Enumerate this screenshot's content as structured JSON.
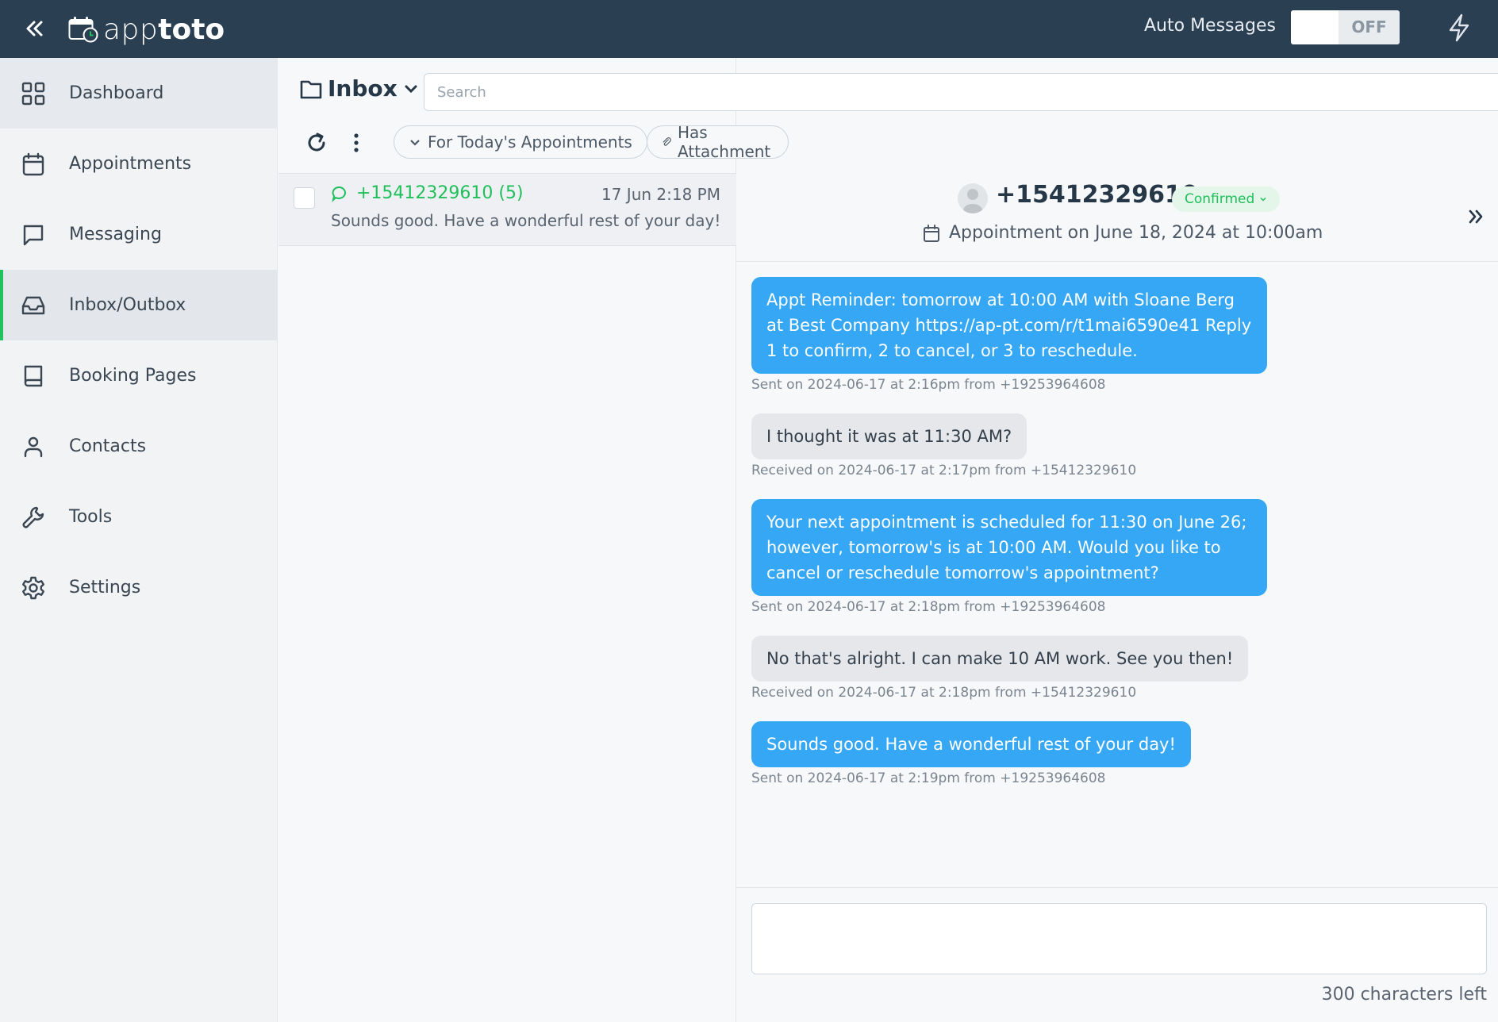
{
  "app": {
    "brand_light": "app",
    "brand_bold": "toto"
  },
  "topbar": {
    "auto_messages_label": "Auto Messages",
    "auto_messages_state": "OFF"
  },
  "sidebar": {
    "items": [
      {
        "label": "Dashboard",
        "icon": "grid-icon"
      },
      {
        "label": "Appointments",
        "icon": "calendar-icon"
      },
      {
        "label": "Messaging",
        "icon": "chat-icon"
      },
      {
        "label": "Inbox/Outbox",
        "icon": "inbox-icon",
        "active": true
      },
      {
        "label": "Booking Pages",
        "icon": "book-icon"
      },
      {
        "label": "Contacts",
        "icon": "user-icon"
      },
      {
        "label": "Tools",
        "icon": "wrench-icon"
      },
      {
        "label": "Settings",
        "icon": "gear-icon"
      }
    ]
  },
  "inbox": {
    "folder_label": "Inbox",
    "search_placeholder": "Search",
    "filters": [
      {
        "label": "For Today's Appointments",
        "icon": "chevron-down-icon"
      },
      {
        "label": "Has Attachment",
        "icon": "paperclip-icon"
      }
    ],
    "threads": [
      {
        "from": "+15412329610 (5)",
        "time": "17 Jun 2:18 PM",
        "preview": "Sounds good. Have a wonderful rest of your day!"
      }
    ]
  },
  "conversation": {
    "phone": "+15412329610",
    "status": "Confirmed",
    "appointment": "Appointment on June 18, 2024 at  10:00am",
    "messages": [
      {
        "direction": "out",
        "text": "Appt Reminder: tomorrow at 10:00 AM with Sloane Berg at Best Company https://ap-pt.com/r/t1mai6590e41 Reply 1 to confirm, 2 to cancel, or 3 to reschedule.",
        "meta": "Sent on 2024-06-17 at 2:16pm from +19253964608"
      },
      {
        "direction": "in",
        "text": "I thought it was at 11:30 AM?",
        "meta": "Received on 2024-06-17 at 2:17pm from +15412329610"
      },
      {
        "direction": "out",
        "text": "Your next appointment is scheduled for 11:30 on June 26; however, tomorrow's is at 10:00 AM. Would you like to cancel or reschedule tomorrow's appointment?",
        "meta": "Sent on 2024-06-17 at 2:18pm from +19253964608"
      },
      {
        "direction": "in",
        "text": "No that's alright. I can make 10 AM work. See you then!",
        "meta": "Received on 2024-06-17 at 2:18pm from +15412329610"
      },
      {
        "direction": "out",
        "text": "Sounds good. Have a wonderful rest of your day!",
        "meta": "Sent on 2024-06-17 at 2:19pm from +19253964608"
      }
    ],
    "composer_value": "",
    "chars_left": "300 characters left"
  },
  "colors": {
    "topbar": "#2b3f53",
    "accent_green": "#1fbf5a",
    "sent_bubble": "#35a7f5",
    "received_bubble": "#e5e7ea"
  }
}
